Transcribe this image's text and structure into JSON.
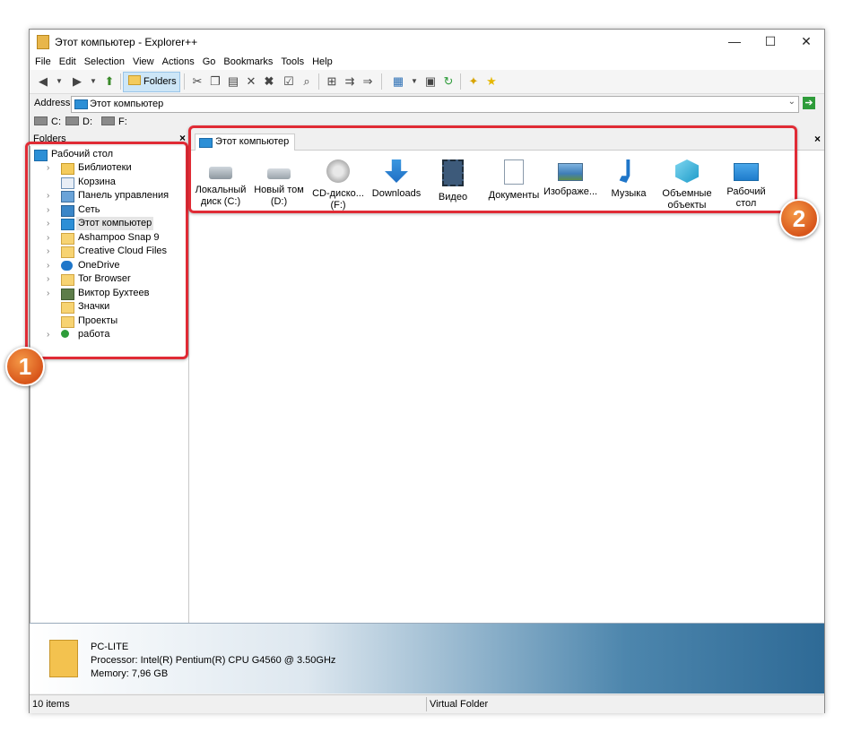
{
  "window": {
    "title": "Этот компьютер - Explorer++",
    "minimize": "—",
    "maximize": "☐",
    "close": "✕"
  },
  "menu": [
    "File",
    "Edit",
    "Selection",
    "View",
    "Actions",
    "Go",
    "Bookmarks",
    "Tools",
    "Help"
  ],
  "toolbar": {
    "folders_label": "Folders"
  },
  "address": {
    "label": "Address",
    "value": "Этот компьютер"
  },
  "drives": [
    "C:",
    "D:",
    "F:"
  ],
  "folders_pane": {
    "title": "Folders",
    "close": "×"
  },
  "tree": [
    {
      "label": "Рабочий стол",
      "icon": "desktop-icon"
    },
    {
      "label": "Библиотеки",
      "icon": "libraries-icon"
    },
    {
      "label": "Корзина",
      "icon": "recycle-bin-icon"
    },
    {
      "label": "Панель управления",
      "icon": "control-panel-icon"
    },
    {
      "label": "Сеть",
      "icon": "network-icon"
    },
    {
      "label": "Этот компьютер",
      "icon": "computer-icon"
    },
    {
      "label": "Ashampoo Snap 9",
      "icon": "folder-icon"
    },
    {
      "label": "Creative Cloud Files",
      "icon": "creative-cloud-icon"
    },
    {
      "label": "OneDrive",
      "icon": "onedrive-icon"
    },
    {
      "label": "Tor Browser",
      "icon": "folder-icon"
    },
    {
      "label": "Виктор Бухтеев",
      "icon": "user-icon"
    },
    {
      "label": "Значки",
      "icon": "folder-icon"
    },
    {
      "label": "Проекты",
      "icon": "folder-icon"
    },
    {
      "label": "работа",
      "icon": "sync-folder-icon"
    }
  ],
  "tab": {
    "label": "Этот компьютер",
    "close": "×"
  },
  "items": [
    {
      "label": "Локальный диск (C:)",
      "icon": "local-disk-icon"
    },
    {
      "label": "Новый том (D:)",
      "icon": "drive-icon"
    },
    {
      "label": "CD-диско... (F:)",
      "icon": "cd-drive-icon"
    },
    {
      "label": "Downloads",
      "icon": "downloads-icon"
    },
    {
      "label": "Видео",
      "icon": "video-icon"
    },
    {
      "label": "Документы",
      "icon": "documents-icon"
    },
    {
      "label": "Изображе...",
      "icon": "pictures-icon"
    },
    {
      "label": "Музыка",
      "icon": "music-icon"
    },
    {
      "label": "Объемные объекты",
      "icon": "3d-objects-icon"
    },
    {
      "label": "Рабочий стол",
      "icon": "desktop-icon"
    }
  ],
  "info": {
    "name": "PC-LITE",
    "processor": "Processor: Intel(R) Pentium(R) CPU G4560 @ 3.50GHz",
    "memory": "Memory: 7,96 GB"
  },
  "status": {
    "items": "10 items",
    "location": "Virtual Folder"
  },
  "callouts": [
    "1",
    "2"
  ],
  "colors": {
    "callout": "#e02b35",
    "badge": "#e8742a",
    "selection": "#e5e5e5"
  }
}
